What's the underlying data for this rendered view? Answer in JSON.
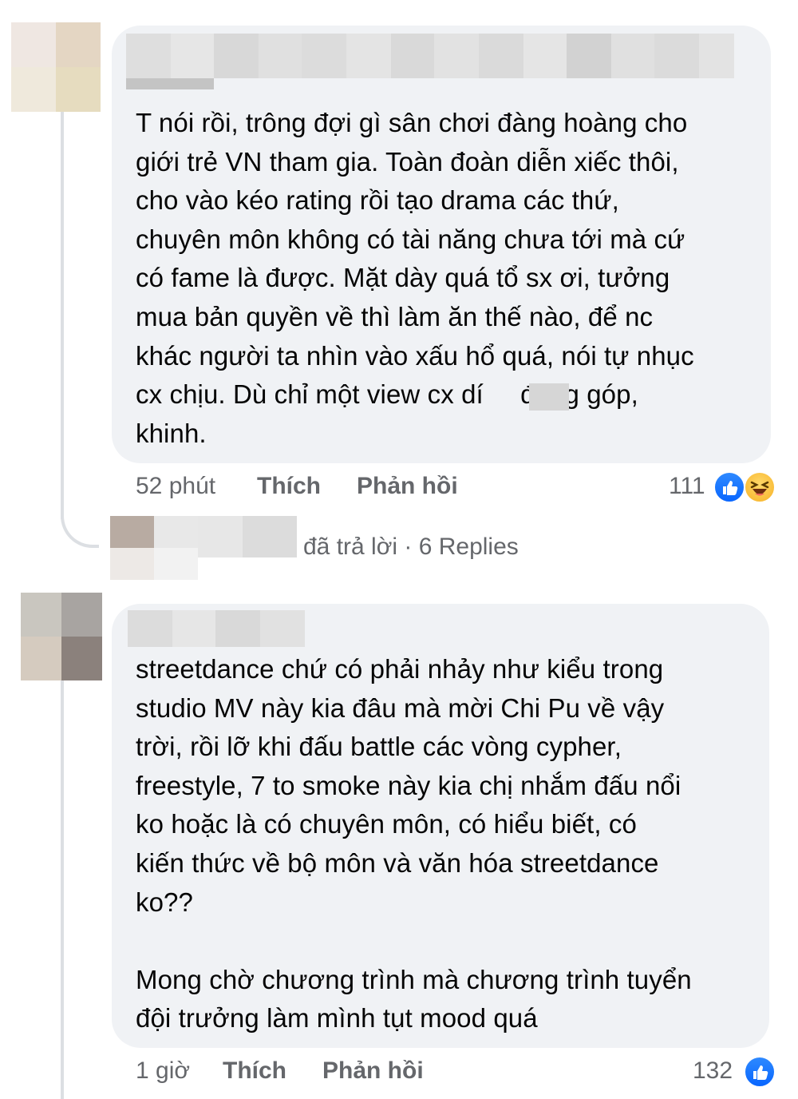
{
  "comments": [
    {
      "text": "T nói rồi, trông đợi gì sân chơi đàng hoàng cho\ngiới trẻ VN tham gia. Toàn đoàn diễn xiếc thôi,\ncho vào kéo rating rồi tạo drama các thứ,\nchuyên môn không có tài năng chưa tới mà cứ\ncó fame là được. Mặt dày quá tổ sx ơi, tưởng\nmua bản quyền về thì làm ăn thế nào, để nc\nkhác người ta nhìn vào xấu hổ quá, nói tự nhục\ncx chịu. Dù chỉ một view cx dí     đóng góp,\nkhinh.",
      "time": "52 phút",
      "like_label": "Thích",
      "reply_label": "Phản hồi",
      "reaction_count": "111",
      "reactions": [
        "like-icon",
        "haha-icon"
      ]
    },
    {
      "text": "streetdance chứ có phải nhảy như kiểu trong\nstudio MV này kia đâu mà mời Chi Pu về vậy\ntrời, rồi lỡ khi đấu battle các vòng cypher,\nfreestyle, 7 to smoke này kia chị nhắm đấu nổi\nko hoặc là có chuyên môn, có hiểu biết, có\nkiến thức về bộ môn và văn hóa streetdance\nko??\n\nMong chờ chương trình mà chương trình tuyển\nđội trưởng làm mình tụt mood quá",
      "time": "1 giờ",
      "like_label": "Thích",
      "reply_label": "Phản hồi",
      "reaction_count": "132",
      "reactions": [
        "like-icon"
      ]
    }
  ],
  "reply_summary": {
    "text": "đã trả lời · 6 Replies"
  },
  "colors": {
    "bubble": "#f0f2f5",
    "meta_text": "#65676b",
    "like_blue": "#0866ff",
    "thread_line": "#dcdfe3"
  }
}
